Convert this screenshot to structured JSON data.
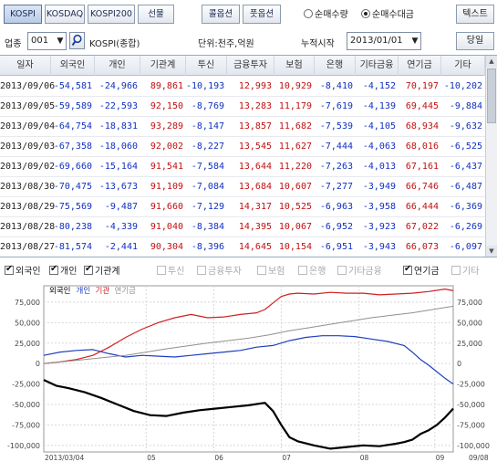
{
  "toolbar": {
    "markets": [
      "KOSPI",
      "KOSDAQ",
      "KOSPI200",
      "선물",
      "콜옵션",
      "풋옵션"
    ],
    "active_market": 0,
    "radio1": "순매수량",
    "radio2": "순매수대금",
    "radio_selected": 2,
    "text_button": "텍스트"
  },
  "filter": {
    "industry_label": "업종",
    "industry_code": "001",
    "industry_name": "KOSPI(종합)",
    "unit_label": "단위:천주,억원",
    "accum_label": "누적시작",
    "accum_date": "2013/01/01",
    "next_button": "당일"
  },
  "table": {
    "columns": [
      "일자",
      "외국인",
      "개인",
      "기관계",
      "투신",
      "금융투자",
      "보험",
      "은행",
      "기타금융",
      "연기금",
      "기타"
    ],
    "rows": [
      [
        "2013/09/06",
        "-54,581",
        "-24,966",
        "89,861",
        "-10,193",
        "12,993",
        "10,929",
        "-8,410",
        "-4,152",
        "70,197",
        "-10,202"
      ],
      [
        "2013/09/05",
        "-59,589",
        "-22,593",
        "92,150",
        "-8,769",
        "13,283",
        "11,179",
        "-7,619",
        "-4,139",
        "69,445",
        "-9,884"
      ],
      [
        "2013/09/04",
        "-64,754",
        "-18,831",
        "93,289",
        "-8,147",
        "13,857",
        "11,682",
        "-7,539",
        "-4,105",
        "68,934",
        "-9,632"
      ],
      [
        "2013/09/03",
        "-67,358",
        "-18,060",
        "92,002",
        "-8,227",
        "13,545",
        "11,627",
        "-7,444",
        "-4,063",
        "68,016",
        "-6,525"
      ],
      [
        "2013/09/02",
        "-69,660",
        "-15,164",
        "91,541",
        "-7,584",
        "13,644",
        "11,220",
        "-7,263",
        "-4,013",
        "67,161",
        "-6,437"
      ],
      [
        "2013/08/30",
        "-70,475",
        "-13,673",
        "91,109",
        "-7,084",
        "13,684",
        "10,607",
        "-7,277",
        "-3,949",
        "66,746",
        "-6,487"
      ],
      [
        "2013/08/29",
        "-75,569",
        "-9,487",
        "91,660",
        "-7,129",
        "14,317",
        "10,525",
        "-6,963",
        "-3,958",
        "66,444",
        "-6,369"
      ],
      [
        "2013/08/28",
        "-80,238",
        "-4,339",
        "91,040",
        "-8,384",
        "14,395",
        "10,067",
        "-6,952",
        "-3,923",
        "67,022",
        "-6,269"
      ],
      [
        "2013/08/27",
        "-81,574",
        "-2,441",
        "90,304",
        "-8,396",
        "14,645",
        "10,154",
        "-6,951",
        "-3,943",
        "66,073",
        "-6,097"
      ]
    ]
  },
  "series_toggles": [
    {
      "label": "외국인",
      "checked": true
    },
    {
      "label": "개인",
      "checked": true
    },
    {
      "label": "기관계",
      "checked": true
    },
    {
      "label": "투신",
      "checked": false
    },
    {
      "label": "금융투자",
      "checked": false
    },
    {
      "label": "보험",
      "checked": false
    },
    {
      "label": "은행",
      "checked": false
    },
    {
      "label": "기타금융",
      "checked": false
    },
    {
      "label": "연기금",
      "checked": true
    },
    {
      "label": "기타",
      "checked": false
    }
  ],
  "chart_data": {
    "type": "line",
    "legend": [
      {
        "name": "외국인",
        "color": "#000000"
      },
      {
        "name": "개인",
        "color": "#1f3fbf"
      },
      {
        "name": "기관",
        "color": "#d02020"
      },
      {
        "name": "연기금",
        "color": "#909090"
      }
    ],
    "x_ticks": [
      "2013/03/04",
      "05",
      "06",
      "07",
      "08",
      "09",
      "09/08"
    ],
    "y_ticks": [
      75000,
      50000,
      25000,
      0,
      -25000,
      -50000,
      -75000,
      -100000
    ],
    "y_tick_labels": [
      "75,000",
      "50,000",
      "25,000",
      "0",
      "-25,000",
      "-50,000",
      "-75,000",
      "-100,000"
    ],
    "ylim": [
      -108000,
      95000
    ],
    "grid": true,
    "x_range": [
      0,
      100
    ],
    "series": [
      {
        "name": "외국인",
        "color": "#000000",
        "width": 2.2,
        "x": [
          0,
          3,
          6,
          10,
          14,
          18,
          22,
          26,
          30,
          34,
          38,
          42,
          46,
          50,
          54,
          56,
          58,
          60,
          62,
          66,
          70,
          74,
          78,
          82,
          86,
          88,
          90,
          92,
          94,
          96,
          98,
          100
        ],
        "y": [
          -20000,
          -27000,
          -30000,
          -35000,
          -42000,
          -50000,
          -58000,
          -63000,
          -64000,
          -60000,
          -57000,
          -55000,
          -53000,
          -51000,
          -48000,
          -58000,
          -75000,
          -90000,
          -95000,
          -100000,
          -104000,
          -102000,
          -100000,
          -101000,
          -98000,
          -96000,
          -93000,
          -86000,
          -81500,
          -75000,
          -66000,
          -55000
        ]
      },
      {
        "name": "개인",
        "color": "#1f3fbf",
        "width": 1.2,
        "x": [
          0,
          4,
          8,
          12,
          16,
          20,
          24,
          28,
          32,
          36,
          40,
          44,
          48,
          52,
          56,
          60,
          64,
          68,
          72,
          76,
          80,
          84,
          88,
          90,
          92,
          94,
          96,
          98,
          100
        ],
        "y": [
          10000,
          14000,
          16000,
          17000,
          12000,
          8000,
          10000,
          9000,
          8000,
          10000,
          12000,
          14000,
          16000,
          20000,
          22000,
          28000,
          32000,
          34000,
          34000,
          33000,
          30000,
          27000,
          22000,
          14000,
          5000,
          -2000,
          -10000,
          -18000,
          -25000
        ]
      },
      {
        "name": "기관",
        "color": "#d02020",
        "width": 1.2,
        "x": [
          0,
          4,
          8,
          12,
          16,
          20,
          24,
          28,
          32,
          36,
          40,
          44,
          48,
          52,
          54,
          56,
          58,
          60,
          62,
          66,
          70,
          74,
          78,
          82,
          86,
          90,
          94,
          98,
          100
        ],
        "y": [
          0,
          2000,
          5000,
          10000,
          20000,
          32000,
          42000,
          50000,
          56000,
          60000,
          56000,
          57000,
          60000,
          62000,
          66000,
          74000,
          82000,
          85000,
          86000,
          85000,
          87000,
          86000,
          86000,
          84000,
          85000,
          86000,
          88000,
          91000,
          89000
        ]
      },
      {
        "name": "연기금",
        "color": "#909090",
        "width": 1.0,
        "x": [
          0,
          10,
          20,
          30,
          40,
          50,
          55,
          60,
          65,
          70,
          75,
          80,
          85,
          90,
          95,
          100
        ],
        "y": [
          0,
          5000,
          10000,
          18000,
          25000,
          31000,
          35000,
          40000,
          44000,
          48000,
          52000,
          56000,
          59000,
          62000,
          66000,
          70000
        ]
      }
    ]
  }
}
